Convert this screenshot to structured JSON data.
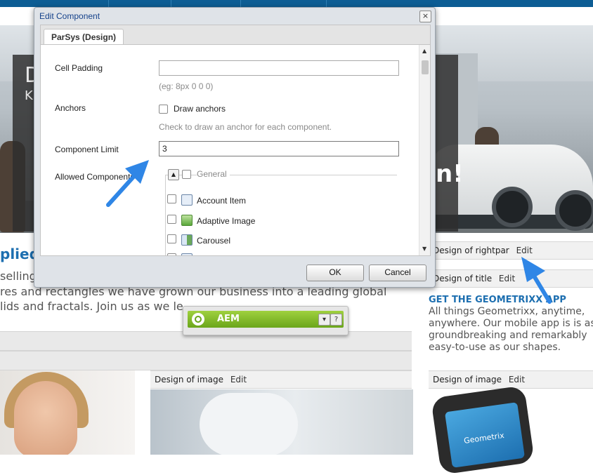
{
  "page": {
    "hero_fragment_d": "D",
    "hero_fragment_k": "K",
    "hero_fragment_bang": "n!",
    "applied_fragment": "plied",
    "body_lines": [
      "selling",
      "res and rectangles we have grown our business into a leading global",
      "lids and fractals. Join us as we le..."
    ],
    "design_bars": {
      "rightpar": {
        "label": "Design of rightpar",
        "edit": "Edit"
      },
      "title": {
        "label": "Design of title",
        "edit": "Edit"
      },
      "image_center": {
        "label": "Design of image",
        "edit": "Edit"
      },
      "image_right": {
        "label": "Design of image",
        "edit": "Edit"
      }
    },
    "app": {
      "title": "GET THE GEOMETRIXX APP",
      "lines": [
        "All things Geometrixx, anytime,",
        "anywhere. Our mobile app is is as",
        "groundbreaking and remarkably",
        "easy-to-use as our shapes."
      ],
      "phone_brand": "Geometrix"
    }
  },
  "sidekick": {
    "label": "AEM",
    "menu_symbol": "▾",
    "help_symbol": "?"
  },
  "dialog": {
    "title": "Edit Component",
    "close_symbol": "×",
    "tab": "ParSys (Design)",
    "fields": {
      "cell_padding": {
        "label": "Cell Padding",
        "value": "",
        "hint": "(eg: 8px 0 0 0)"
      },
      "anchors": {
        "label": "Anchors",
        "checkbox_label": "Draw anchors",
        "hint": "Check to draw an anchor for each component."
      },
      "component_limit": {
        "label": "Component Limit",
        "value": "3"
      },
      "allowed_components": {
        "label": "Allowed Components"
      }
    },
    "group": {
      "name": "General",
      "items": [
        "Account Item",
        "Adaptive Image",
        "Carousel"
      ]
    },
    "ok": "OK",
    "cancel": "Cancel"
  },
  "colors": {
    "link_blue": "#1d6fb0",
    "annotation_arrow": "#2f86e6",
    "sidekick_green": "#7bb427"
  }
}
